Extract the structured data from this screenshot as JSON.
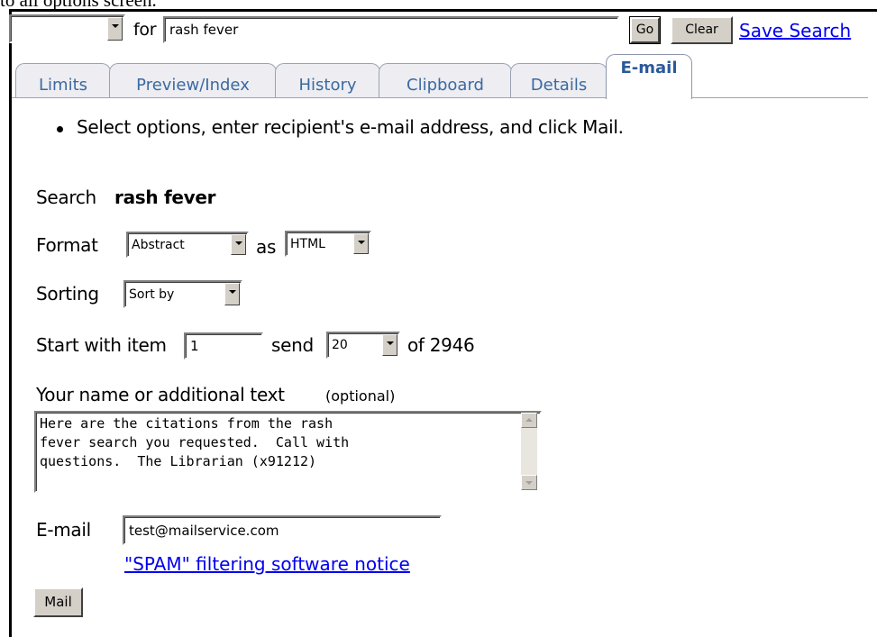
{
  "caption": "to all options screen.",
  "search_bar": {
    "db_select_value": "",
    "for_label": "for",
    "query": "rash fever",
    "go_label": "Go",
    "clear_label": "Clear",
    "save_search_label": "Save Search"
  },
  "tabs": [
    {
      "label": "Limits",
      "active": false
    },
    {
      "label": "Preview/Index",
      "active": false
    },
    {
      "label": "History",
      "active": false
    },
    {
      "label": "Clipboard",
      "active": false
    },
    {
      "label": "Details",
      "active": false
    },
    {
      "label": "E-mail",
      "active": true
    }
  ],
  "instruction": "Select options, enter recipient's e-mail address, and click Mail.",
  "form": {
    "search_label": "Search",
    "search_term": "rash fever",
    "format_label": "Format",
    "format_value": "Abstract",
    "as_label": "as",
    "as_value": "HTML",
    "sorting_label": "Sorting",
    "sorting_value": "Sort by",
    "start_label": "Start with item",
    "start_value": "1",
    "send_label": "send",
    "send_value": "20",
    "of_label": "of 2946",
    "name_label": "Your name or additional text",
    "name_optional": "(optional)",
    "name_text": "Here are the citations from the rash\nfever search you requested.  Call with\nquestions.  The Librarian (x91212)",
    "email_label": "E-mail",
    "email_value": "test@mailservice.com",
    "spam_notice": "\"SPAM\" filtering software notice",
    "mail_button": "Mail"
  },
  "colors": {
    "tab_text": "#3b6aa0",
    "link": "#0000ee",
    "button_face": "#d4d0c8"
  }
}
